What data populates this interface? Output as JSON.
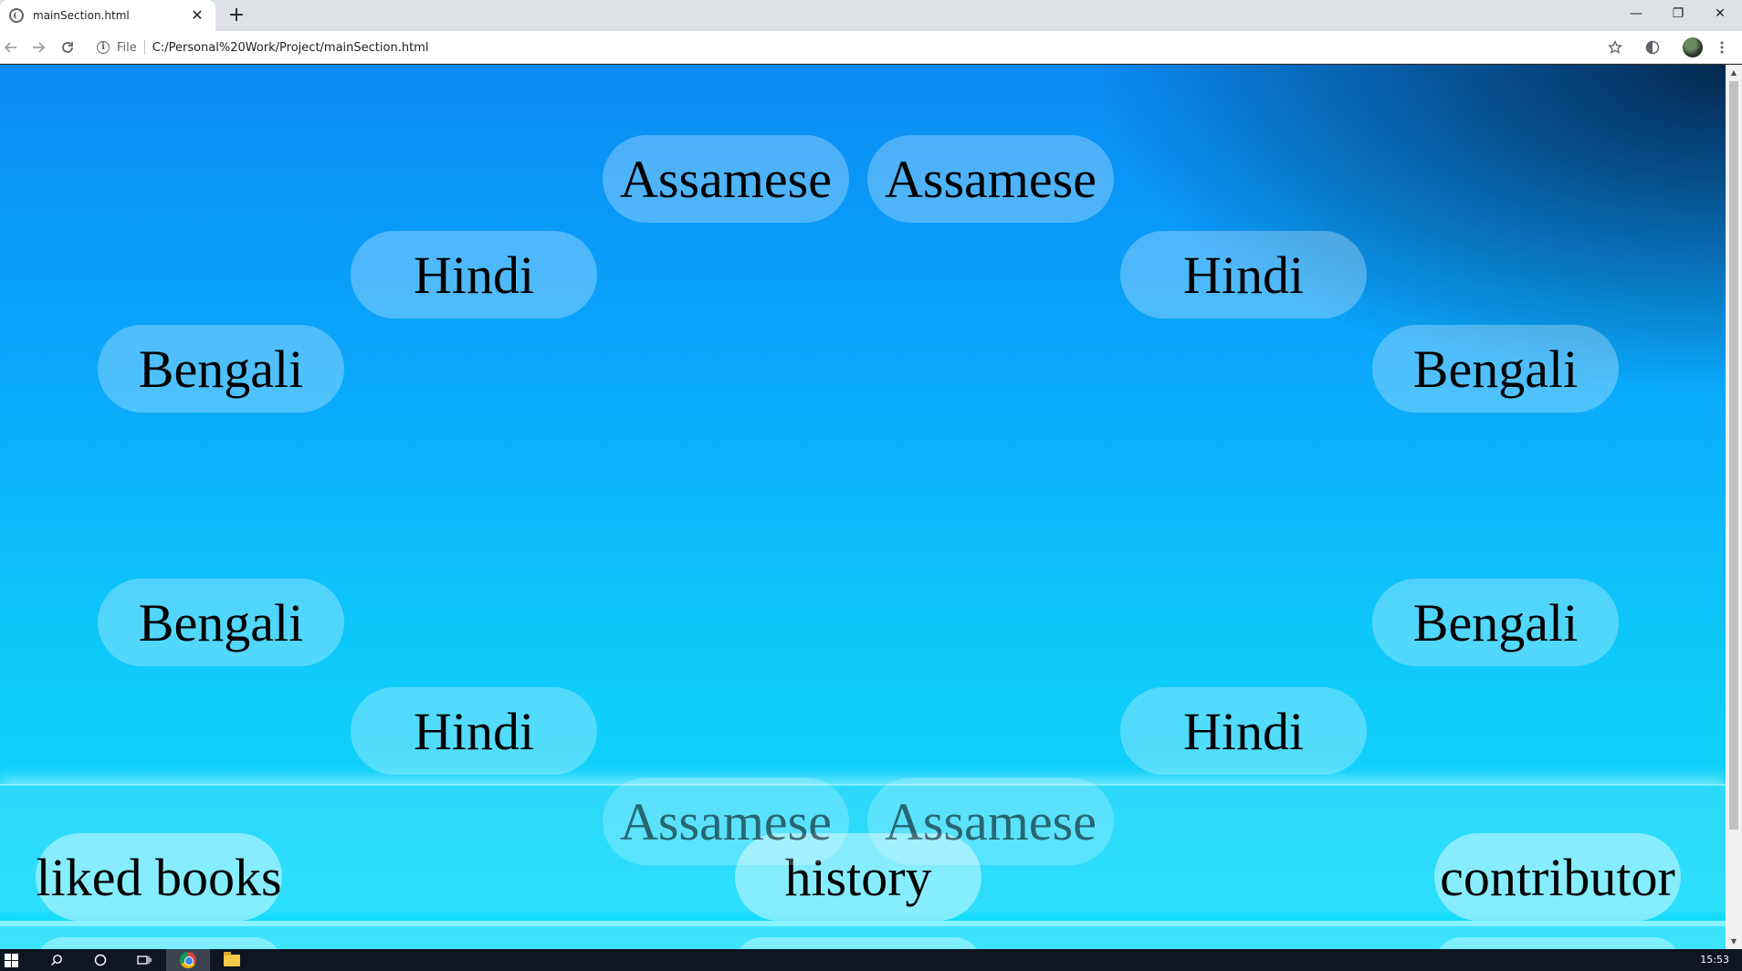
{
  "browser": {
    "tab_title": "mainSection.html",
    "tab_close": "✕",
    "new_tab": "+",
    "scheme": "File",
    "url": "C:/Personal%20Work/Project/mainSection.html",
    "window_controls": {
      "minimize": "—",
      "restore": "❐",
      "close": "✕"
    },
    "icons": {
      "back": "back-arrow-icon",
      "forward": "forward-arrow-icon",
      "reload": "reload-icon",
      "info": "info-icon",
      "bookmark": "star-icon",
      "extension": "extension-icon",
      "menu": "menu-icon"
    }
  },
  "page": {
    "languages": {
      "top_left": "Assamese",
      "top_right": "Assamese",
      "upper_left_mid": "Hindi",
      "upper_right_mid": "Hindi",
      "left_upper": "Bengali",
      "right_upper": "Bengali",
      "left_lower": "Bengali",
      "right_lower": "Bengali",
      "lower_left_mid": "Hindi",
      "lower_right_mid": "Hindi",
      "bottom_left": "Assamese",
      "bottom_right": "Assamese"
    },
    "bottom_nav": {
      "liked": "liked books",
      "history": "history",
      "contributor": "contributor"
    },
    "colors": {
      "background_top": "#0a8bf5",
      "background_bottom": "#12ddfb"
    }
  },
  "taskbar": {
    "clock": "15:53"
  }
}
